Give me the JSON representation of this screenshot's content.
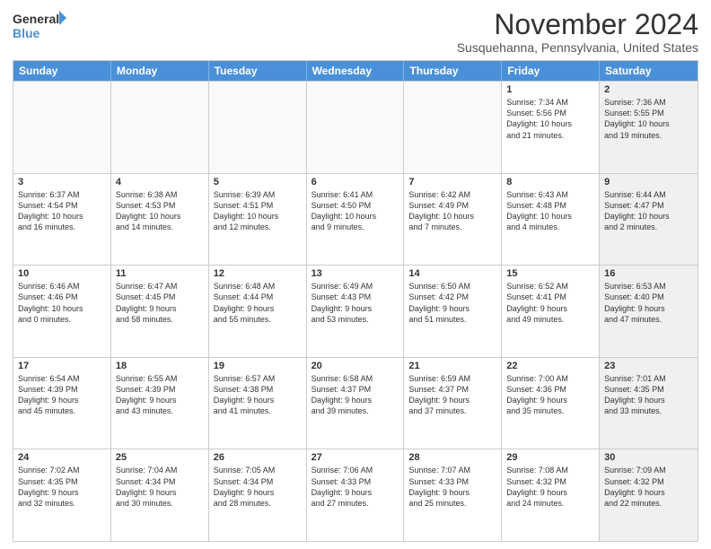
{
  "logo": {
    "line1": "General",
    "line2": "Blue"
  },
  "title": "November 2024",
  "subtitle": "Susquehanna, Pennsylvania, United States",
  "days_of_week": [
    "Sunday",
    "Monday",
    "Tuesday",
    "Wednesday",
    "Thursday",
    "Friday",
    "Saturday"
  ],
  "weeks": [
    [
      {
        "day": "",
        "info": "",
        "shaded": false,
        "empty": true
      },
      {
        "day": "",
        "info": "",
        "shaded": false,
        "empty": true
      },
      {
        "day": "",
        "info": "",
        "shaded": false,
        "empty": true
      },
      {
        "day": "",
        "info": "",
        "shaded": false,
        "empty": true
      },
      {
        "day": "",
        "info": "",
        "shaded": false,
        "empty": true
      },
      {
        "day": "1",
        "info": "Sunrise: 7:34 AM\nSunset: 5:56 PM\nDaylight: 10 hours\nand 21 minutes.",
        "shaded": false,
        "empty": false
      },
      {
        "day": "2",
        "info": "Sunrise: 7:36 AM\nSunset: 5:55 PM\nDaylight: 10 hours\nand 19 minutes.",
        "shaded": true,
        "empty": false
      }
    ],
    [
      {
        "day": "3",
        "info": "Sunrise: 6:37 AM\nSunset: 4:54 PM\nDaylight: 10 hours\nand 16 minutes.",
        "shaded": false,
        "empty": false
      },
      {
        "day": "4",
        "info": "Sunrise: 6:38 AM\nSunset: 4:53 PM\nDaylight: 10 hours\nand 14 minutes.",
        "shaded": false,
        "empty": false
      },
      {
        "day": "5",
        "info": "Sunrise: 6:39 AM\nSunset: 4:51 PM\nDaylight: 10 hours\nand 12 minutes.",
        "shaded": false,
        "empty": false
      },
      {
        "day": "6",
        "info": "Sunrise: 6:41 AM\nSunset: 4:50 PM\nDaylight: 10 hours\nand 9 minutes.",
        "shaded": false,
        "empty": false
      },
      {
        "day": "7",
        "info": "Sunrise: 6:42 AM\nSunset: 4:49 PM\nDaylight: 10 hours\nand 7 minutes.",
        "shaded": false,
        "empty": false
      },
      {
        "day": "8",
        "info": "Sunrise: 6:43 AM\nSunset: 4:48 PM\nDaylight: 10 hours\nand 4 minutes.",
        "shaded": false,
        "empty": false
      },
      {
        "day": "9",
        "info": "Sunrise: 6:44 AM\nSunset: 4:47 PM\nDaylight: 10 hours\nand 2 minutes.",
        "shaded": true,
        "empty": false
      }
    ],
    [
      {
        "day": "10",
        "info": "Sunrise: 6:46 AM\nSunset: 4:46 PM\nDaylight: 10 hours\nand 0 minutes.",
        "shaded": false,
        "empty": false
      },
      {
        "day": "11",
        "info": "Sunrise: 6:47 AM\nSunset: 4:45 PM\nDaylight: 9 hours\nand 58 minutes.",
        "shaded": false,
        "empty": false
      },
      {
        "day": "12",
        "info": "Sunrise: 6:48 AM\nSunset: 4:44 PM\nDaylight: 9 hours\nand 55 minutes.",
        "shaded": false,
        "empty": false
      },
      {
        "day": "13",
        "info": "Sunrise: 6:49 AM\nSunset: 4:43 PM\nDaylight: 9 hours\nand 53 minutes.",
        "shaded": false,
        "empty": false
      },
      {
        "day": "14",
        "info": "Sunrise: 6:50 AM\nSunset: 4:42 PM\nDaylight: 9 hours\nand 51 minutes.",
        "shaded": false,
        "empty": false
      },
      {
        "day": "15",
        "info": "Sunrise: 6:52 AM\nSunset: 4:41 PM\nDaylight: 9 hours\nand 49 minutes.",
        "shaded": false,
        "empty": false
      },
      {
        "day": "16",
        "info": "Sunrise: 6:53 AM\nSunset: 4:40 PM\nDaylight: 9 hours\nand 47 minutes.",
        "shaded": true,
        "empty": false
      }
    ],
    [
      {
        "day": "17",
        "info": "Sunrise: 6:54 AM\nSunset: 4:39 PM\nDaylight: 9 hours\nand 45 minutes.",
        "shaded": false,
        "empty": false
      },
      {
        "day": "18",
        "info": "Sunrise: 6:55 AM\nSunset: 4:39 PM\nDaylight: 9 hours\nand 43 minutes.",
        "shaded": false,
        "empty": false
      },
      {
        "day": "19",
        "info": "Sunrise: 6:57 AM\nSunset: 4:38 PM\nDaylight: 9 hours\nand 41 minutes.",
        "shaded": false,
        "empty": false
      },
      {
        "day": "20",
        "info": "Sunrise: 6:58 AM\nSunset: 4:37 PM\nDaylight: 9 hours\nand 39 minutes.",
        "shaded": false,
        "empty": false
      },
      {
        "day": "21",
        "info": "Sunrise: 6:59 AM\nSunset: 4:37 PM\nDaylight: 9 hours\nand 37 minutes.",
        "shaded": false,
        "empty": false
      },
      {
        "day": "22",
        "info": "Sunrise: 7:00 AM\nSunset: 4:36 PM\nDaylight: 9 hours\nand 35 minutes.",
        "shaded": false,
        "empty": false
      },
      {
        "day": "23",
        "info": "Sunrise: 7:01 AM\nSunset: 4:35 PM\nDaylight: 9 hours\nand 33 minutes.",
        "shaded": true,
        "empty": false
      }
    ],
    [
      {
        "day": "24",
        "info": "Sunrise: 7:02 AM\nSunset: 4:35 PM\nDaylight: 9 hours\nand 32 minutes.",
        "shaded": false,
        "empty": false
      },
      {
        "day": "25",
        "info": "Sunrise: 7:04 AM\nSunset: 4:34 PM\nDaylight: 9 hours\nand 30 minutes.",
        "shaded": false,
        "empty": false
      },
      {
        "day": "26",
        "info": "Sunrise: 7:05 AM\nSunset: 4:34 PM\nDaylight: 9 hours\nand 28 minutes.",
        "shaded": false,
        "empty": false
      },
      {
        "day": "27",
        "info": "Sunrise: 7:06 AM\nSunset: 4:33 PM\nDaylight: 9 hours\nand 27 minutes.",
        "shaded": false,
        "empty": false
      },
      {
        "day": "28",
        "info": "Sunrise: 7:07 AM\nSunset: 4:33 PM\nDaylight: 9 hours\nand 25 minutes.",
        "shaded": false,
        "empty": false
      },
      {
        "day": "29",
        "info": "Sunrise: 7:08 AM\nSunset: 4:32 PM\nDaylight: 9 hours\nand 24 minutes.",
        "shaded": false,
        "empty": false
      },
      {
        "day": "30",
        "info": "Sunrise: 7:09 AM\nSunset: 4:32 PM\nDaylight: 9 hours\nand 22 minutes.",
        "shaded": true,
        "empty": false
      }
    ]
  ]
}
